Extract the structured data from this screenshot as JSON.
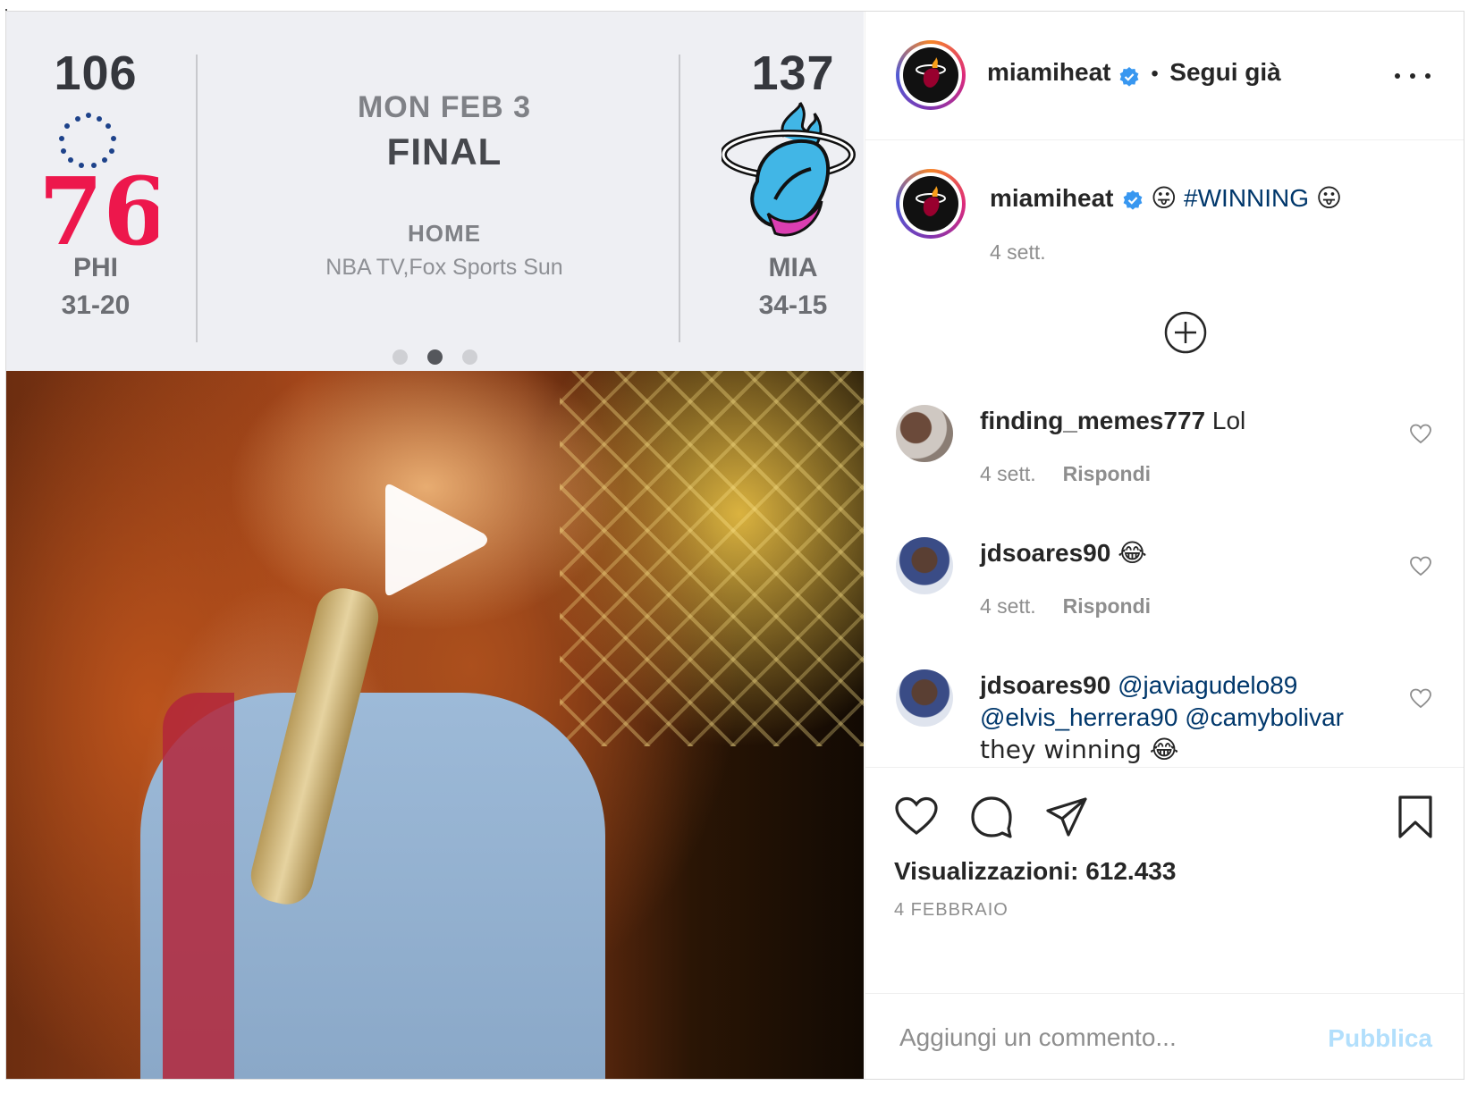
{
  "scoreboard": {
    "away": {
      "score": "106",
      "abbr": "PHI",
      "record": "31-20",
      "logo_text": "76"
    },
    "home": {
      "score": "137",
      "abbr": "MIA",
      "record": "34-15"
    },
    "date": "MON FEB 3",
    "status": "FINAL",
    "venue": "HOME",
    "broadcast": "NBA TV,Fox Sports Sun"
  },
  "carousel": {
    "dots": 3,
    "active_index": 1
  },
  "post": {
    "username": "miamiheat",
    "separator": "•",
    "follow_label": "Segui già",
    "caption": {
      "emoji_left": "😛",
      "hashtag": "#WINNING",
      "emoji_right": "😛",
      "time": "4 sett."
    }
  },
  "comments": [
    {
      "user": "finding_memes777",
      "text": "Lol",
      "mentions": [],
      "tail": "",
      "time": "4 sett.",
      "reply": "Rispondi"
    },
    {
      "user": "jdsoares90",
      "text": "😂",
      "mentions": [],
      "tail": "",
      "time": "4 sett.",
      "reply": "Rispondi"
    },
    {
      "user": "jdsoares90",
      "text": "",
      "mentions": [
        "@javiagudelo89",
        "@elvis_herrera90",
        "@camybolivar"
      ],
      "tail": "they winning 😂",
      "time": "",
      "reply": ""
    }
  ],
  "stats": {
    "views_label": "Visualizzazioni: 612.433",
    "date": "4 FEBBRAIO"
  },
  "composer": {
    "placeholder": "Aggiungi un commento...",
    "publish_label": "Pubblica"
  },
  "colors": {
    "link": "#00376b",
    "muted": "#8e8e8e",
    "verified": "#3897f0",
    "publish_disabled": "#b2dffc"
  },
  "icons": [
    "play-icon",
    "verified-badge-icon",
    "more-options-icon",
    "load-more-comments-icon",
    "heart-icon",
    "comment-icon",
    "share-icon",
    "bookmark-icon"
  ]
}
